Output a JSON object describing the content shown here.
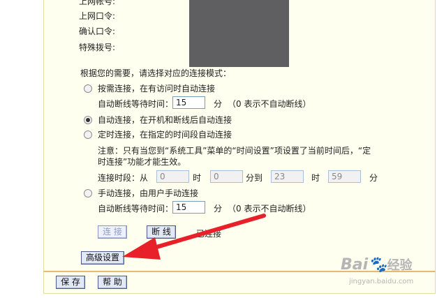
{
  "account": {
    "user_label": "上网帐号:",
    "password_label": "上网口令:",
    "confirm_label": "确认口令:",
    "dial_label": "特殊拨号:"
  },
  "mode": {
    "prompt": "根据您的需要，请选择对应的连接模式：",
    "on_demand_label": "按需连接，在有访问时自动连接",
    "idle_label": "自动断线等待时间：",
    "idle_value_1": "15",
    "minute_unit": "分",
    "idle_hint": "（0 表示不自动断线）",
    "auto_label": "自动连接，在开机和断线后自动连接",
    "timed_label": "定时连接，在指定的时间段自动连接",
    "notice_line1": "注意：只有当您到“系统工具”菜单的“时间设置”项设置了当前时间后，“定",
    "notice_line2": "时连接”功能才能生效。",
    "period_label": "连接时段：从",
    "from_hour": "0",
    "hour_unit": "时",
    "from_min": "0",
    "to_label": "分到",
    "to_hour": "23",
    "to_min": "59",
    "manual_label": "手动连接，由用户手动连接",
    "idle_value_2": "15"
  },
  "actions": {
    "connect_label": "连 接",
    "disconnect_label": "断 线",
    "status": "已连接",
    "advanced_label": "高级设置",
    "save_label": "保 存",
    "help_label": "帮 助"
  },
  "watermark": {
    "brand": "Bai",
    "brand_tail": "经验",
    "url": "jingyan.baidu.com"
  },
  "colors": {
    "arrow": "#e8202a",
    "panel_bg": "#fffff0",
    "footer_border": "#e8b86c"
  }
}
